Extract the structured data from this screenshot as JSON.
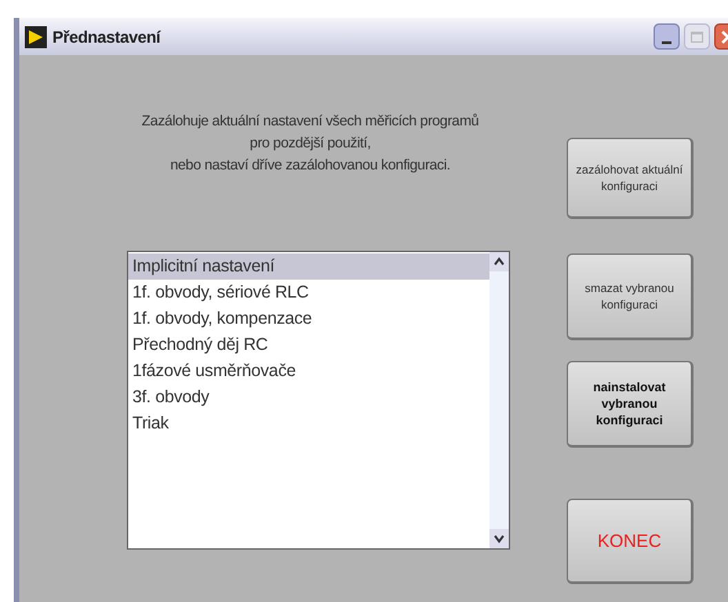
{
  "window": {
    "title": "Přednastavení"
  },
  "description": [
    "Zazálohuje aktuální nastavení všech měřicích programů",
    "pro pozdější použití,",
    "nebo nastaví dříve zazálohovanou konfiguraci."
  ],
  "list": {
    "items": [
      {
        "label": "Implicitní nastavení",
        "selected": true
      },
      {
        "label": "1f. obvody, sériové RLC",
        "selected": false
      },
      {
        "label": "1f. obvody, kompenzace",
        "selected": false
      },
      {
        "label": "Přechodný děj RC",
        "selected": false
      },
      {
        "label": "1fázové usměrňovače",
        "selected": false
      },
      {
        "label": "3f. obvody",
        "selected": false
      },
      {
        "label": "Triak",
        "selected": false
      }
    ]
  },
  "buttons": [
    {
      "label": "zazálohovat aktuální konfiguraci",
      "kind": "normal"
    },
    {
      "label": "smazat vybranou konfiguraci",
      "kind": "normal"
    },
    {
      "label": "nainstalovat vybranou konfiguraci",
      "kind": "bold"
    },
    {
      "label": "KONEC",
      "kind": "exit"
    }
  ]
}
